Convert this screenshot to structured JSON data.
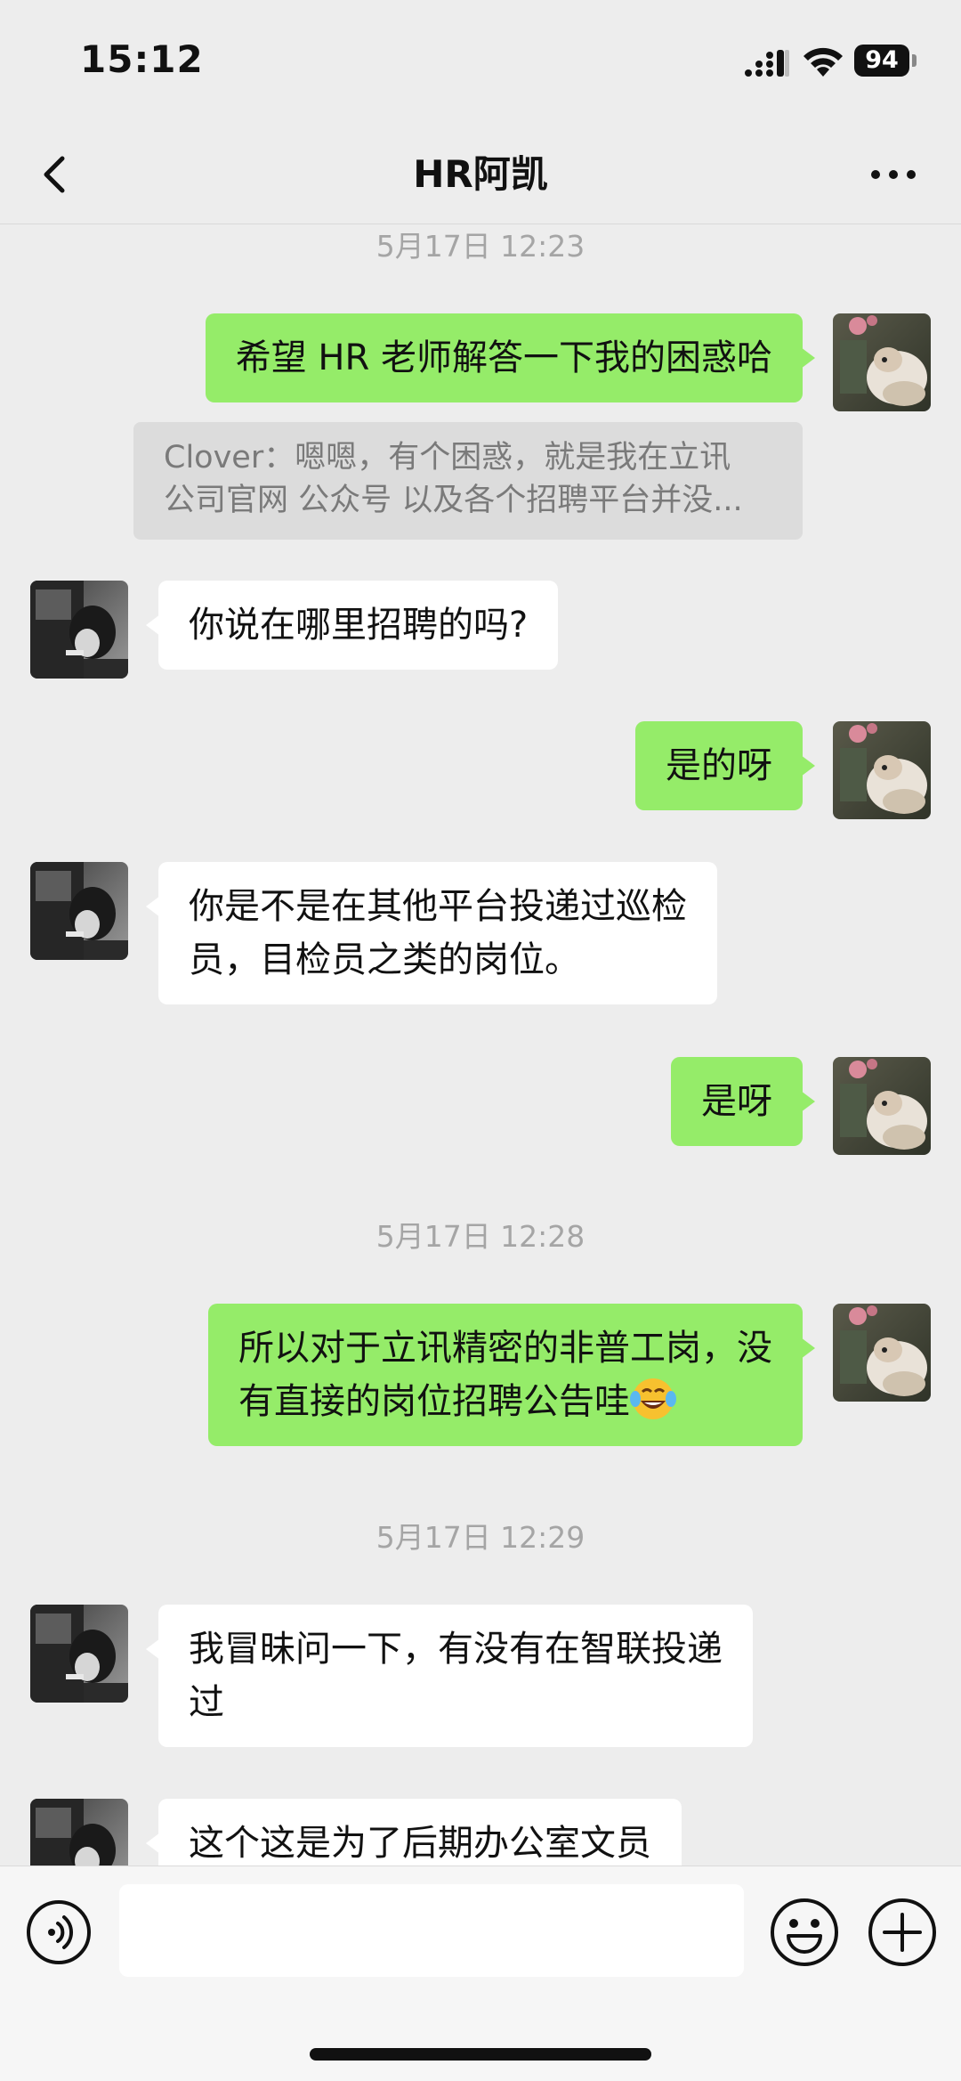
{
  "status_bar": {
    "time": "15:12",
    "battery": "94"
  },
  "nav": {
    "title": "HR阿凯"
  },
  "messages": {
    "ts1": "5月17日 12:23",
    "m1": "希望 HR 老师解答一下我的困惑哈",
    "quote_line1": "Clover：嗯嗯，有个困惑，就是我在立讯",
    "quote_line2": "公司官网 公众号 以及各个招聘平台并没...",
    "m2": "你说在哪里招聘的吗?",
    "m3": "是的呀",
    "m4_line1": "你是不是在其他平台投递过巡检",
    "m4_line2": "员，目检员之类的岗位。",
    "m5": "是呀",
    "ts2": "5月17日 12:28",
    "m6_line1": "所以对于立讯精密的非普工岗，没",
    "m6_line2": "有直接的岗位招聘公告哇",
    "ts3": "5月17日 12:29",
    "m7_line1": "我冒昧问一下，有没有在智联投递",
    "m7_line2": "过",
    "m8": "这个这是为了后期办公室文员"
  },
  "colors": {
    "my_bubble": "#95ec69",
    "their_bubble": "#ffffff",
    "background": "#ededed"
  },
  "icons": [
    "back-icon",
    "more-icon",
    "voice-icon",
    "emoji-icon",
    "plus-icon",
    "tears-of-joy-emoji"
  ]
}
